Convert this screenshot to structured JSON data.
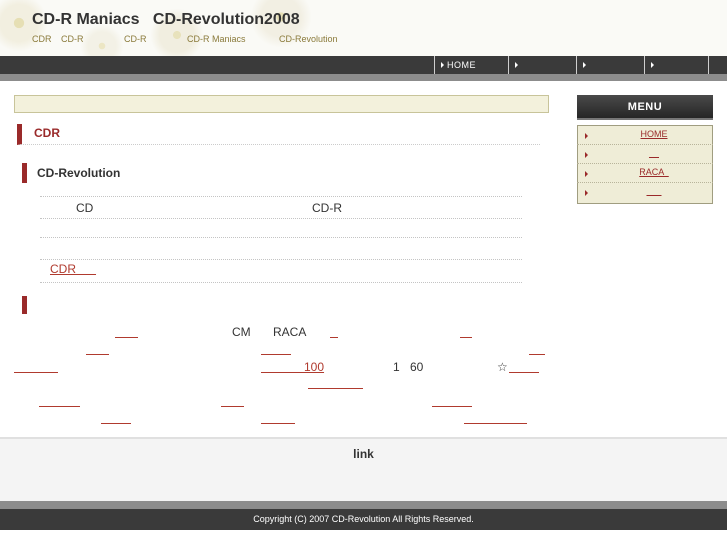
{
  "header": {
    "title": "CD-R Maniacs   CD-Revolution2008",
    "sub_links": [
      "CDR",
      "CD-R",
      "CD-R",
      "CD-R Maniacs",
      "CD-Revolution"
    ]
  },
  "nav": {
    "items": [
      "HOME",
      "",
      "",
      "",
      ""
    ]
  },
  "main": {
    "section_title": "CDR",
    "subsection_title": "CD-Revolution",
    "row1": {
      "left": "CD",
      "right": "CD-R"
    },
    "cdr_link": "CDR      ",
    "para": {
      "cm": "CM",
      "raca": "RACA",
      "hundred": "100",
      "one": "1",
      "sixty": "60",
      "star": "☆"
    }
  },
  "sidebar": {
    "menu_title": "MENU",
    "items": [
      "HOME",
      "    ",
      "RACA  ",
      "      "
    ]
  },
  "footer": {
    "link_title": "link",
    "copyright": "Copyright (C) 2007 CD-Revolution All Rights Reserved."
  }
}
